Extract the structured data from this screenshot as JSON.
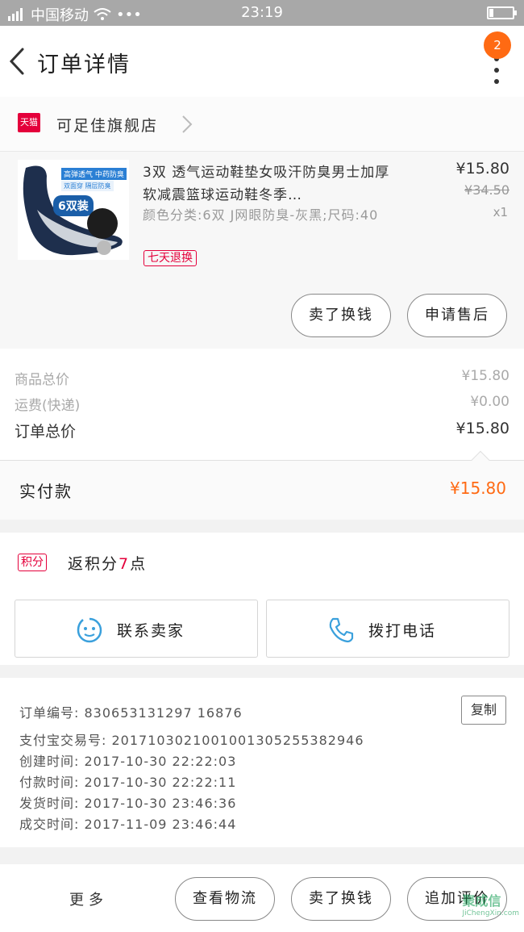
{
  "status_bar": {
    "carrier": "中国移动",
    "dots": "•••",
    "time": "23:19"
  },
  "nav": {
    "title": "订单详情",
    "badge": "2"
  },
  "shop": {
    "tmall_label": "天猫",
    "name": "可足佳旗舰店"
  },
  "item": {
    "thumb_tag1": "高弹透气 中药防臭",
    "thumb_tag2": "双面穿 隔层防臭",
    "thumb_pack": "6双装",
    "title": "3双 透气运动鞋垫女吸汗防臭男士加厚软减震篮球运动鞋冬季…",
    "sku": "颜色分类:6双 J网眼防臭-灰黑;尺码:40",
    "return_tag": "七天退换",
    "price": "¥15.80",
    "original_price": "¥34.50",
    "quantity": "x1",
    "btn_return_money": "卖了换钱",
    "btn_after_sale": "申请售后"
  },
  "costs": {
    "goods_label": "商品总价",
    "goods_value": "¥15.80",
    "shipping_label": "运费(快递)",
    "shipping_value": "¥0.00",
    "total_label": "订单总价",
    "total_value": "¥15.80"
  },
  "paid": {
    "label": "实付款",
    "value": "¥15.80"
  },
  "points": {
    "tag": "积分",
    "text_prefix": "返积分",
    "num": "7",
    "text_suffix": "点"
  },
  "contact": {
    "seller": "联系卖家",
    "call": "拨打电话"
  },
  "order": {
    "number": "订单编号: 830653131297 16876",
    "alipay": "支付宝交易号: 2017103021001001305255382946",
    "created": "创建时间: 2017-10-30 22:22:03",
    "paid": "付款时间: 2017-10-30 22:22:11",
    "shipped": "发货时间: 2017-10-30 23:46:36",
    "completed": "成交时间: 2017-11-09 23:46:44",
    "copy": "复制"
  },
  "bottom": {
    "more": "更多",
    "logistics": "查看物流",
    "sell": "卖了换钱",
    "review": "追加评价"
  },
  "watermark": {
    "text": "聚成信",
    "url": "JiChengXin.com"
  },
  "colors": {
    "accent": "#ff6a13",
    "tmall": "#e4003b",
    "icon_blue": "#3aa0dc"
  }
}
